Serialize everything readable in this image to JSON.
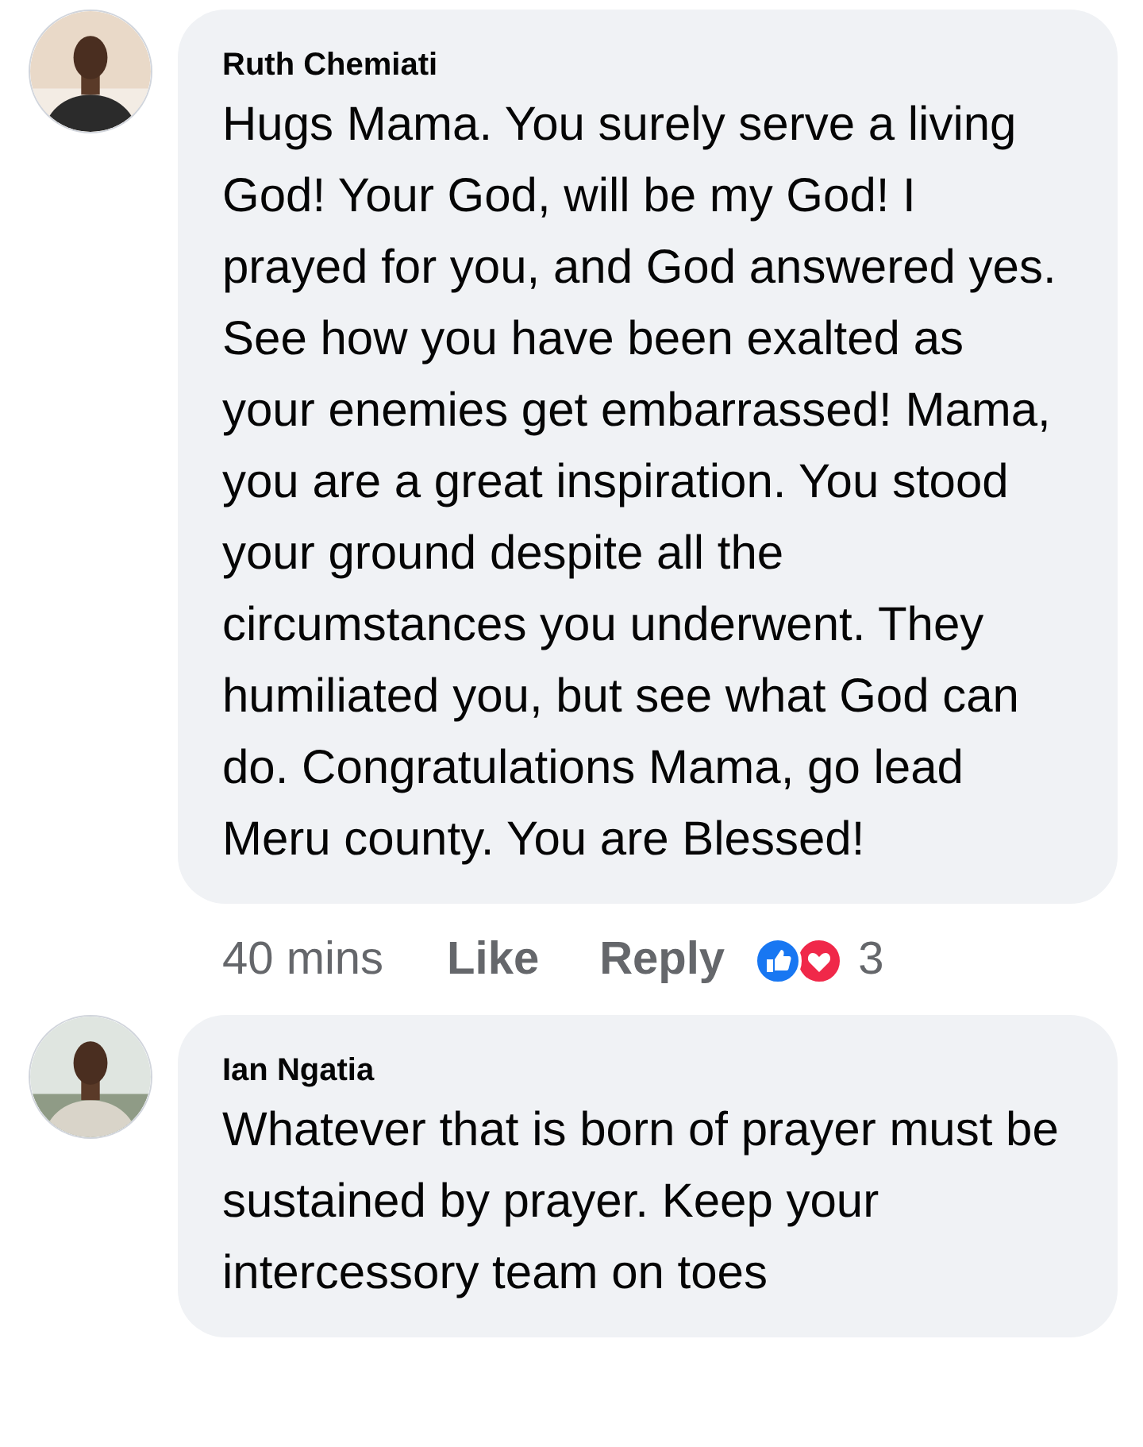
{
  "comments": [
    {
      "author": "Ruth Chemiati",
      "text": "Hugs Mama. You surely serve a living God! Your God, will be my God! I prayed for you, and God answered yes. See how you have been exalted as your enemies get embarrassed! Mama, you are a great inspiration. You stood your ground despite all the circumstances you underwent. They humiliated you, but see what God can do. Congratulations Mama, go lead Meru county. You are Blessed!",
      "time": "40 mins",
      "actions": [
        "Like",
        "Reply"
      ],
      "reactions": [
        {
          "kind": "like"
        },
        {
          "kind": "love"
        }
      ],
      "reaction_count": "3"
    },
    {
      "author": "Ian Ngatia",
      "text": "Whatever that is born of prayer must be sustained by prayer. Keep your intercessory team on toes"
    }
  ]
}
